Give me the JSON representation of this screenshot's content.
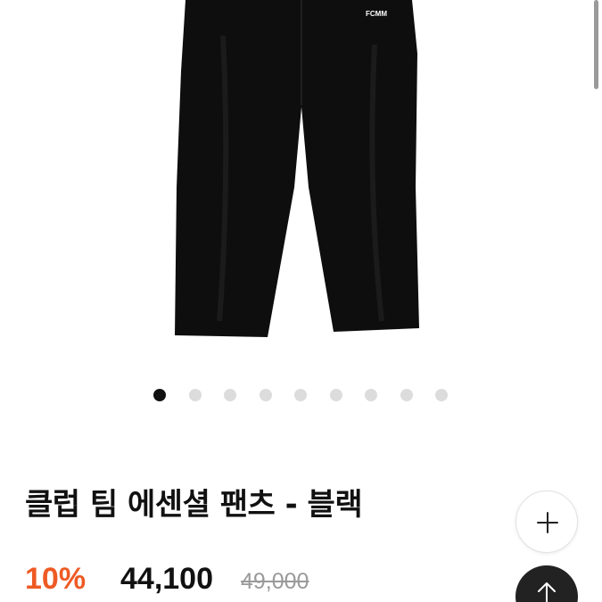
{
  "product": {
    "image_icon": "black-sweatpants-photo",
    "logo_text": "FCMM",
    "title": "클럽 팀 에센셜 팬츠 - 블랙",
    "discount": "10%",
    "sale_price": "44,100",
    "original_price": "49,000"
  },
  "carousel": {
    "total": 9,
    "active_index": 0
  },
  "actions": {
    "add_icon": "plus-icon",
    "top_icon": "arrow-up-icon"
  },
  "colors": {
    "discount": "#ee5a24",
    "active_dot": "#111111",
    "inactive_dot": "#dcdcdc",
    "top_button": "#222222"
  }
}
